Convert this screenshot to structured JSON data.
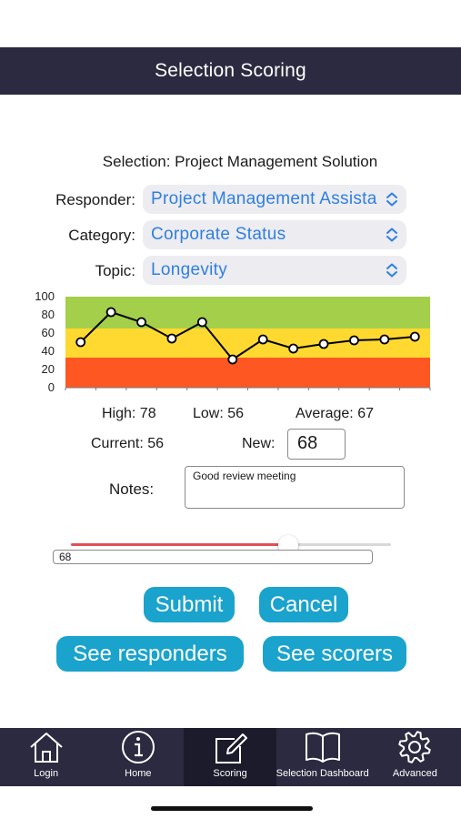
{
  "nav": {
    "title": "Selection Scoring"
  },
  "selection": {
    "text": "Selection: Project Management Solution"
  },
  "fields": {
    "responder": {
      "label": "Responder:",
      "value": "Project Management Assistant"
    },
    "category": {
      "label": "Category:",
      "value": "Corporate Status"
    },
    "topic": {
      "label": "Topic:",
      "value": "Longevity"
    }
  },
  "chart_data": {
    "type": "line",
    "ylim": [
      0,
      100
    ],
    "yticks": [
      "100",
      "80",
      "60",
      "40",
      "20",
      "0"
    ],
    "bands": [
      {
        "from": 0,
        "to": 33,
        "color": "#ff5722"
      },
      {
        "from": 33,
        "to": 65,
        "color": "#ffd930"
      },
      {
        "from": 65,
        "to": 100,
        "color": "#a3cf4a"
      }
    ],
    "series": [
      {
        "values": [
          50,
          83,
          72,
          54,
          72,
          31,
          53,
          43,
          48,
          52,
          53,
          56
        ],
        "color": "#000000"
      }
    ],
    "grid": false
  },
  "stats": {
    "high": "High: 78",
    "low": "Low: 56",
    "average": "Average: 67"
  },
  "current": {
    "label": "Current: 56"
  },
  "new_score": {
    "label": "New:",
    "value": "68"
  },
  "notes": {
    "label": "Notes:",
    "value": "Good review meeting"
  },
  "slider": {
    "value": 68,
    "min": 0,
    "max": 100
  },
  "value_field": {
    "value": "68"
  },
  "buttons": {
    "submit": "Submit",
    "cancel": "Cancel",
    "see_responders": "See responders",
    "see_scorers": "See scorers"
  },
  "tabs": [
    {
      "label": "Login",
      "icon": "house-icon",
      "active": false
    },
    {
      "label": "Home",
      "icon": "info-icon",
      "active": false
    },
    {
      "label": "Scoring",
      "icon": "edit-icon",
      "active": true
    },
    {
      "label": "Selection Dashboard",
      "icon": "book-icon",
      "active": false
    },
    {
      "label": "Advanced",
      "icon": "gear-icon",
      "active": false
    }
  ],
  "colors": {
    "bar": "#2b2a40",
    "accent": "#2f7fe0",
    "button": "#1aa3cc",
    "slider_fill": "#e2505a"
  }
}
